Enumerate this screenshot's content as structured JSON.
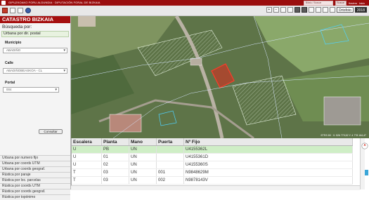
{
  "banner": {
    "title": "GIPUZKOAKO FORU ALDUNDIA · DIPUTACIÓN FORAL DE BIZKAIA",
    "search_placeholder": "Bilatu / Buscar",
    "search_button": "Buscar",
    "links": [
      "Hasiera",
      "Inicio"
    ]
  },
  "toolbar": {
    "basemap_label": "Ortofoto",
    "basemap_year": "2018"
  },
  "left": {
    "app_title": "CATASTRO BIZKAIA",
    "search_by": "Búsqueda por:",
    "active_tab": "Urbana por dir. postal",
    "municipio_label": "Municipio",
    "municipio_value": "ABADIÑO",
    "calle_label": "Calle",
    "calle_value": "ABADIÑOBEASKOA - CL",
    "portal_label": "Portal",
    "portal_value": "004",
    "consultar": "Consultar",
    "menu": [
      "Urbana por numero fijo",
      "Urbana por coords UTM",
      "Urbana por coords geograf.",
      "Rústica por paraje",
      "Rústica por loc. parcelas",
      "Rústica por coords UTM",
      "Rústica por coords geograf.",
      "Rústica por topónimo"
    ]
  },
  "map": {
    "coords": "ETRS 89 · X: 526 779,52  Y: 4 778 164,47"
  },
  "table": {
    "columns": [
      "Escalera",
      "Planta",
      "Mano",
      "Puerta",
      "Nº Fijo"
    ],
    "rows": [
      [
        "U",
        "PB",
        "UN",
        "",
        "U4155362L"
      ],
      [
        "U",
        "01",
        "UN",
        "",
        "U4155361D"
      ],
      [
        "U",
        "02",
        "UN",
        "",
        "U4155360S"
      ],
      [
        "T",
        "03",
        "UN",
        "001",
        "N9848629M"
      ],
      [
        "T",
        "03",
        "UN",
        "002",
        "N9878143V"
      ]
    ]
  },
  "colors": {
    "brand": "#a50f0f",
    "selected_row": "#cfeec6",
    "parcel_highlight": "#e0281e"
  }
}
